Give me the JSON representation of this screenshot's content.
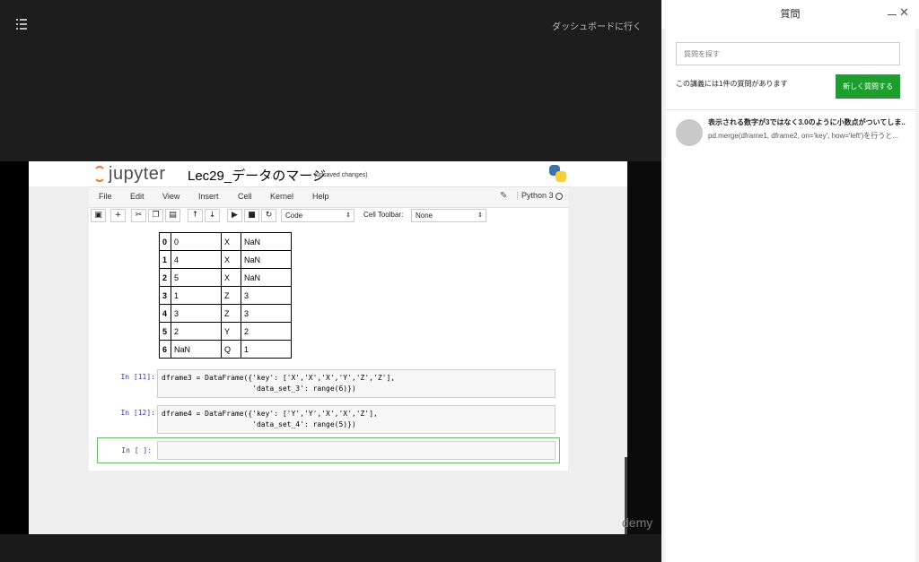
{
  "topbar": {
    "dashboard_link": "ダッシュボードに行く"
  },
  "jupyter": {
    "logo_text": "jupyter",
    "title": "Lec29_データのマージ",
    "status": "(unsaved changes)",
    "menu": [
      "File",
      "Edit",
      "View",
      "Insert",
      "Cell",
      "Kernel",
      "Help"
    ],
    "kernel": "Python 3",
    "toolbar": {
      "icons": [
        "save-icon",
        "plus-icon",
        "cut-icon",
        "copy-icon",
        "paste-icon",
        "arrow-up-icon",
        "arrow-down-icon",
        "run-icon",
        "stop-icon",
        "restart-icon"
      ],
      "cell_type": "Code",
      "cell_toolbar_label": "Cell Toolbar:",
      "cell_toolbar_value": "None"
    },
    "table": {
      "rows": [
        [
          "0",
          "0",
          "X",
          "NaN"
        ],
        [
          "1",
          "4",
          "X",
          "NaN"
        ],
        [
          "2",
          "5",
          "X",
          "NaN"
        ],
        [
          "3",
          "1",
          "Z",
          "3"
        ],
        [
          "4",
          "3",
          "Z",
          "3"
        ],
        [
          "5",
          "2",
          "Y",
          "2"
        ],
        [
          "6",
          "NaN",
          "Q",
          "1"
        ]
      ]
    },
    "cells": [
      {
        "prompt": "In [11]:",
        "line1": "dframe3 = DataFrame({'key': ['X','X','X','Y','Z','Z'],",
        "line2": "                     'data_set_3': range(6)})"
      },
      {
        "prompt": "In [12]:",
        "line1": "dframe4 = DataFrame({'key': ['Y','Y','X','X','Z'],",
        "line2": "                     'data_set_4': range(5)})"
      }
    ],
    "active_prompt": "In [ ]:"
  },
  "watermark": "demy",
  "panel": {
    "title": "質問",
    "search_placeholder": "質問を探す",
    "count_text": "この講義には1件の質問があります",
    "new_question_button": "新しく質問する",
    "questions": [
      {
        "title": "表示される数字が3ではなく3.0のように小数点がついてしま...",
        "excerpt": "pd.merge(dframe1, dframe2, on='key', how='left')を行うと..."
      }
    ]
  },
  "colors": {
    "accent_green": "#1e9e2e",
    "jupyter_orange": "#f37726",
    "prompt_blue": "#303f9f"
  }
}
